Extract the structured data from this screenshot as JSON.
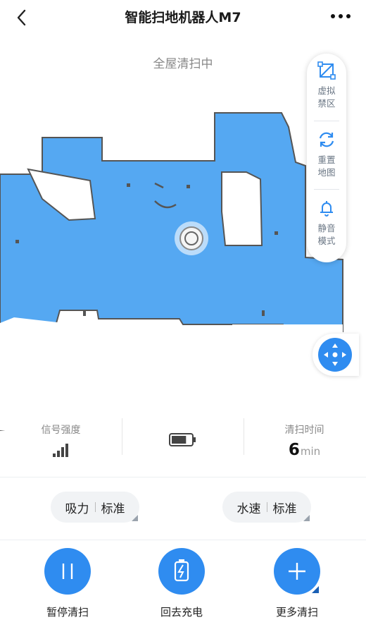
{
  "header": {
    "title": "智能扫地机器人M7"
  },
  "status_text": "全屋清扫中",
  "side_panel": {
    "items": [
      {
        "label": "虚拟禁区",
        "icon": "virtual-zone-icon"
      },
      {
        "label": "重置地图",
        "icon": "refresh-icon"
      },
      {
        "label": "静音模式",
        "icon": "bell-icon"
      }
    ]
  },
  "stats": {
    "signal_label": "信号强度",
    "signal_bars": 4,
    "battery_level": 0.75,
    "time_label": "清扫时间",
    "time_value": "6",
    "time_unit": "min"
  },
  "controls": {
    "suction_label": "吸力",
    "suction_value": "标准",
    "water_label": "水速",
    "water_value": "标准"
  },
  "actions": [
    {
      "label": "暂停清扫",
      "icon": "pause-icon"
    },
    {
      "label": "回去充电",
      "icon": "charge-icon"
    },
    {
      "label": "更多清扫",
      "icon": "plus-icon"
    }
  ],
  "colors": {
    "accent": "#2f8cf0",
    "map_fill": "#55a8f2",
    "map_wall": "#555555"
  }
}
